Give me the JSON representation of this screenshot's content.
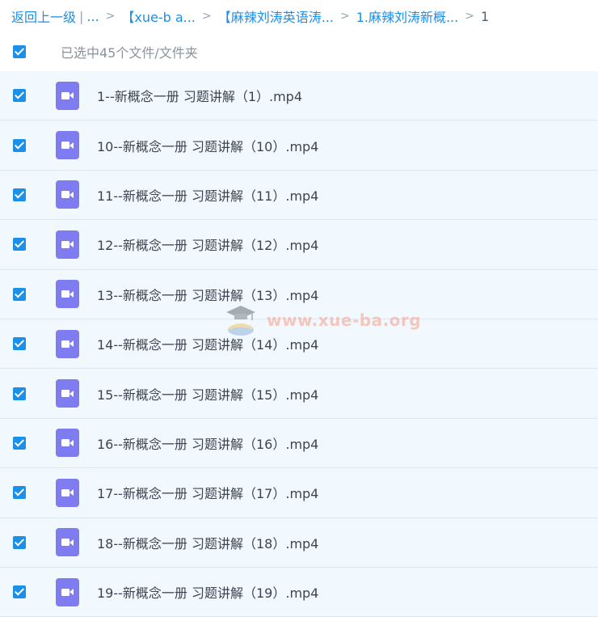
{
  "breadcrumb": {
    "back_label": "返回上一级",
    "pipe": "|",
    "ellipsis": "...",
    "chevron": ">",
    "items": [
      "【xue-b a...",
      "【麻辣刘涛英语涛...",
      "1.麻辣刘涛新概..."
    ],
    "current": "1"
  },
  "selection": {
    "count_text": "已选中45个文件/文件夹"
  },
  "files": [
    "1--新概念一册 习题讲解（1）.mp4",
    "10--新概念一册 习题讲解（10）.mp4",
    "11--新概念一册 习题讲解（11）.mp4",
    "12--新概念一册 习题讲解（12）.mp4",
    "13--新概念一册 习题讲解（13）.mp4",
    "14--新概念一册 习题讲解（14）.mp4",
    "15--新概念一册 习题讲解（15）.mp4",
    "16--新概念一册 习题讲解（16）.mp4",
    "17--新概念一册 习题讲解（17）.mp4",
    "18--新概念一册 习题讲解（18）.mp4",
    "19--新概念一册 习题讲解（19）.mp4"
  ],
  "watermark": {
    "text": "www.xue-ba.org",
    "icon": "graduation-cap-book-icon"
  },
  "colors": {
    "accent": "#1c8fe8",
    "video_icon": "#7f7cf2",
    "row_bg": "#f2f9fe",
    "watermark": "#f5a08a"
  }
}
